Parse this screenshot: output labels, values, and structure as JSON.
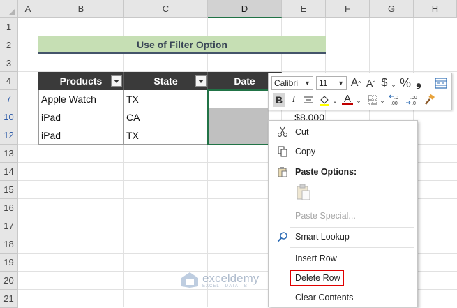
{
  "columns": [
    "A",
    "B",
    "C",
    "D",
    "E",
    "F",
    "G",
    "H"
  ],
  "rows": [
    "1",
    "2",
    "3",
    "4",
    "7",
    "10",
    "12",
    "13",
    "14",
    "15",
    "16",
    "17",
    "18",
    "19",
    "20",
    "21"
  ],
  "title": "Use of Filter Option",
  "table": {
    "headers": [
      "Products",
      "State",
      "Date"
    ],
    "rows": [
      [
        "Apple Watch",
        "TX",
        ""
      ],
      [
        "iPad",
        "CA",
        ""
      ],
      [
        "iPad",
        "TX",
        ""
      ]
    ],
    "partial_value": "$8,000"
  },
  "mini_toolbar": {
    "font": "Calibri",
    "size": "11",
    "grow_font": "A",
    "shrink_font": "A",
    "currency": "$",
    "percent": "%",
    "comma": "❟",
    "bold": "B",
    "italic": "I",
    "font_color": "A"
  },
  "context_menu": {
    "cut": "Cut",
    "copy": "Copy",
    "paste_options": "Paste Options:",
    "paste_special": "Paste Special...",
    "smart_lookup": "Smart Lookup",
    "insert_row": "Insert Row",
    "delete_row": "Delete Row",
    "clear_contents": "Clear Contents"
  },
  "watermark": {
    "brand": "exceldemy",
    "tagline": "EXCEL · DATA · BI"
  },
  "colors": {
    "accent_green": "#217346",
    "title_fill": "#c6dfb4",
    "header_fill": "#3a3a3a",
    "selection_fill": "#c0c0c0",
    "highlight_red": "#e00000"
  }
}
